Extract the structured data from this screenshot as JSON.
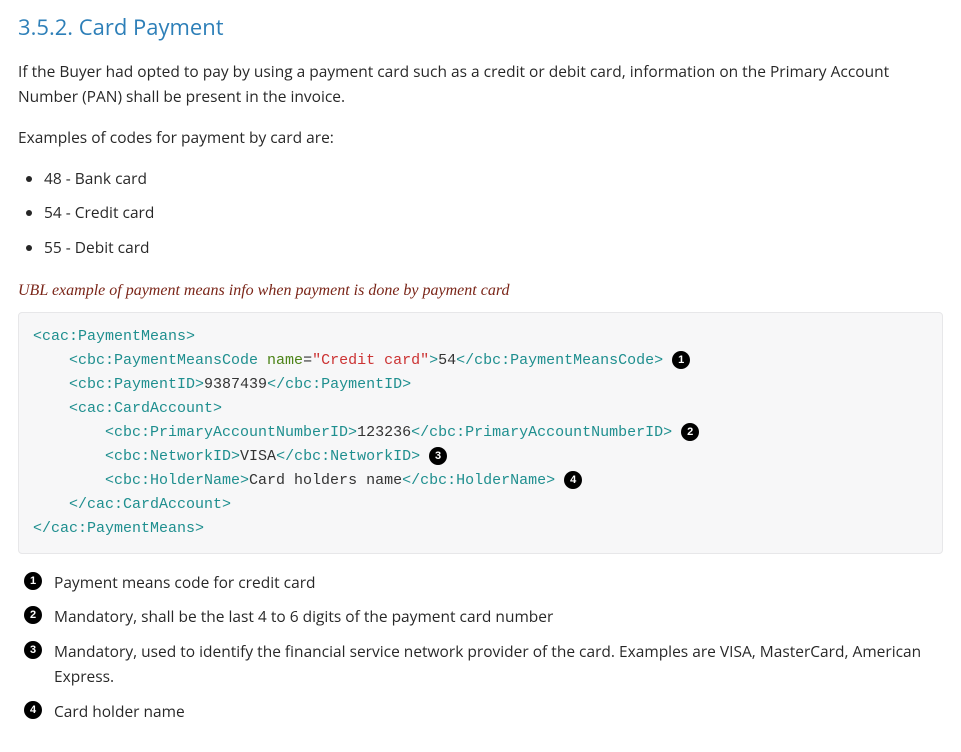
{
  "heading": "3.5.2. Card Payment",
  "intro": "If the Buyer had opted to pay by using a payment card such as a credit or debit card, information on the Primary Account Number (PAN) shall be present in the invoice.",
  "examples_lead": "Examples of codes for payment by card are:",
  "code_examples": [
    "48 - Bank card",
    "54 - Credit card",
    "55 - Debit card"
  ],
  "example_title": "UBL example of payment means info when payment is done by payment card",
  "code": {
    "pm_open": "<cac:PaymentMeans>",
    "pmc_open": "<cbc:PaymentMeansCode",
    "pmc_attr_name": " name",
    "pmc_eq": "=",
    "pmc_attr_val": "\"Credit card\"",
    "pmc_gt": ">",
    "pmc_val": "54",
    "pmc_close": "</cbc:PaymentMeansCode>",
    "pid_open": "<cbc:PaymentID>",
    "pid_val": "9387439",
    "pid_close": "</cbc:PaymentID>",
    "ca_open": "<cac:CardAccount>",
    "pan_open": "<cbc:PrimaryAccountNumberID>",
    "pan_val": "123236",
    "pan_close": "</cbc:PrimaryAccountNumberID>",
    "net_open": "<cbc:NetworkID>",
    "net_val": "VISA",
    "net_close": "</cbc:NetworkID>",
    "hold_open": "<cbc:HolderName>",
    "hold_val": "Card holders name",
    "hold_close": "</cbc:HolderName>",
    "ca_close": "</cac:CardAccount>",
    "pm_close": "</cac:PaymentMeans>"
  },
  "callouts": [
    {
      "n": "1",
      "text": "Payment means code for credit card"
    },
    {
      "n": "2",
      "text": "Mandatory, shall be the last 4 to 6 digits of the payment card number"
    },
    {
      "n": "3",
      "text": "Mandatory, used to identify the financial service network provider of the card. Examples are VISA, MasterCard, American Express."
    },
    {
      "n": "4",
      "text": "Card holder name"
    }
  ]
}
